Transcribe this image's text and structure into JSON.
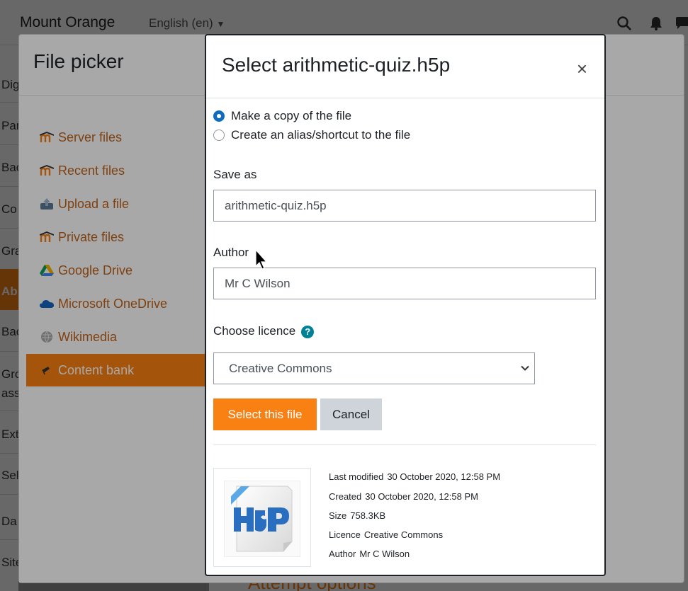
{
  "navbar": {
    "brand": "Mount Orange",
    "language": "English (en)"
  },
  "page": {
    "strip_items": [
      "Dig",
      "Par",
      "Bac",
      "Co",
      "Gra",
      "Ab",
      "Bac",
      "Gro",
      "ass",
      "Ext",
      "Sel",
      "Da",
      "Site"
    ],
    "bottom_heading": "Attempt options"
  },
  "filepicker": {
    "title": "File picker",
    "repositories": [
      {
        "label": "Server files",
        "icon": "moodle-icon"
      },
      {
        "label": "Recent files",
        "icon": "moodle-icon"
      },
      {
        "label": "Upload a file",
        "icon": "upload-icon"
      },
      {
        "label": "Private files",
        "icon": "moodle-icon"
      },
      {
        "label": "Google Drive",
        "icon": "google-drive-icon"
      },
      {
        "label": "Microsoft OneDrive",
        "icon": "onedrive-icon"
      },
      {
        "label": "Wikimedia",
        "icon": "wikimedia-icon"
      },
      {
        "label": "Content bank",
        "icon": "content-bank-icon",
        "active": true
      }
    ]
  },
  "dialog": {
    "title": "Select arithmetic-quiz.h5p",
    "close": "×",
    "options": {
      "copy": "Make a copy of the file",
      "alias": "Create an alias/shortcut to the file",
      "selected": "copy"
    },
    "save_as": {
      "label": "Save as",
      "value": "arithmetic-quiz.h5p"
    },
    "author": {
      "label": "Author",
      "value": "Mr C Wilson"
    },
    "licence": {
      "label": "Choose licence",
      "help": "?",
      "value": "Creative Commons"
    },
    "buttons": {
      "select": "Select this file",
      "cancel": "Cancel"
    },
    "file_info": [
      {
        "key": "Last modified",
        "value": "30 October 2020, 12:58 PM"
      },
      {
        "key": "Created",
        "value": "30 October 2020, 12:58 PM"
      },
      {
        "key": "Size",
        "value": "758.3KB"
      },
      {
        "key": "Licence",
        "value": "Creative Commons"
      },
      {
        "key": "Author",
        "value": "Mr C Wilson"
      }
    ]
  },
  "colors": {
    "accent": "#f98012",
    "link": "#c0631a",
    "radio": "#0f6cbf",
    "help": "#008196"
  }
}
